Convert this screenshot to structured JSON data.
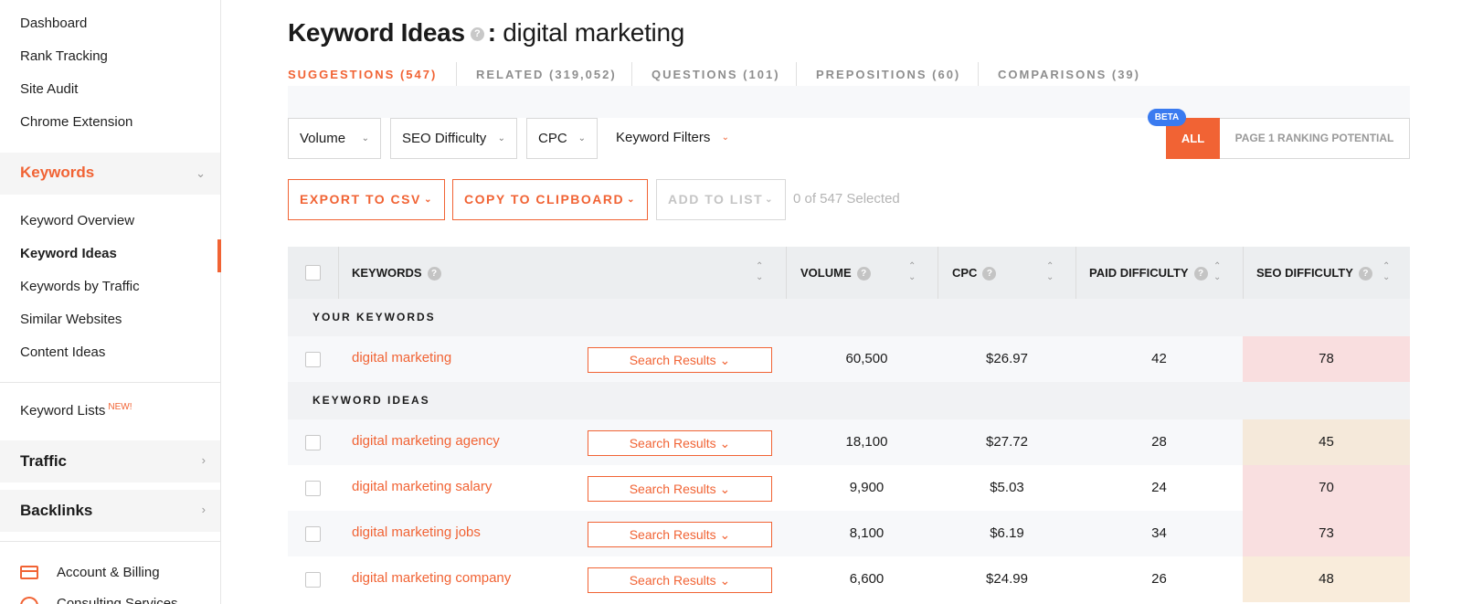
{
  "sidebar": {
    "top_items": [
      "Dashboard",
      "Rank Tracking",
      "Site Audit",
      "Chrome Extension"
    ],
    "keywords_section": "Keywords",
    "keyword_items": [
      "Keyword Overview",
      "Keyword Ideas",
      "Keywords by Traffic",
      "Similar Websites",
      "Content Ideas"
    ],
    "keyword_lists": "Keyword Lists",
    "new_badge": "NEW!",
    "traffic_section": "Traffic",
    "backlinks_section": "Backlinks",
    "account_billing": "Account & Billing",
    "consulting": "Consulting Services"
  },
  "header": {
    "title": "Keyword Ideas",
    "help": "?",
    "colon": ":",
    "keyword": "digital marketing"
  },
  "tabs": [
    "SUGGESTIONS (547)",
    "RELATED (319,052)",
    "QUESTIONS (101)",
    "PREPOSITIONS (60)",
    "COMPARISONS (39)"
  ],
  "filters": {
    "volume": "Volume",
    "seo_difficulty": "SEO Difficulty",
    "cpc": "CPC",
    "keyword_filters": "Keyword Filters"
  },
  "toggle": {
    "beta": "BETA",
    "all": "ALL",
    "page1": "PAGE 1 RANKING POTENTIAL"
  },
  "actions": {
    "export": "EXPORT TO CSV",
    "copy": "COPY TO CLIPBOARD",
    "add_list": "ADD TO LIST",
    "selected": "0 of 547 Selected"
  },
  "table": {
    "columns": [
      "KEYWORDS",
      "VOLUME",
      "CPC",
      "PAID DIFFICULTY",
      "SEO DIFFICULTY"
    ],
    "help": "?",
    "your_keywords_label": "YOUR KEYWORDS",
    "keyword_ideas_label": "KEYWORD IDEAS",
    "search_results_label": "Search Results",
    "your_keywords": [
      {
        "keyword": "digital marketing",
        "volume": "60,500",
        "cpc": "$26.97",
        "paid": "42",
        "seo": "78",
        "seo_color": "#f9dedf"
      }
    ],
    "ideas": [
      {
        "keyword": "digital marketing agency",
        "volume": "18,100",
        "cpc": "$27.72",
        "paid": "28",
        "seo": "45",
        "seo_color": "#f5e9da"
      },
      {
        "keyword": "digital marketing salary",
        "volume": "9,900",
        "cpc": "$5.03",
        "paid": "24",
        "seo": "70",
        "seo_color": "#f9dfe0"
      },
      {
        "keyword": "digital marketing jobs",
        "volume": "8,100",
        "cpc": "$6.19",
        "paid": "34",
        "seo": "73",
        "seo_color": "#f9dfe0"
      },
      {
        "keyword": "digital marketing company",
        "volume": "6,600",
        "cpc": "$24.99",
        "paid": "26",
        "seo": "48",
        "seo_color": "#f9ecdb"
      }
    ]
  }
}
